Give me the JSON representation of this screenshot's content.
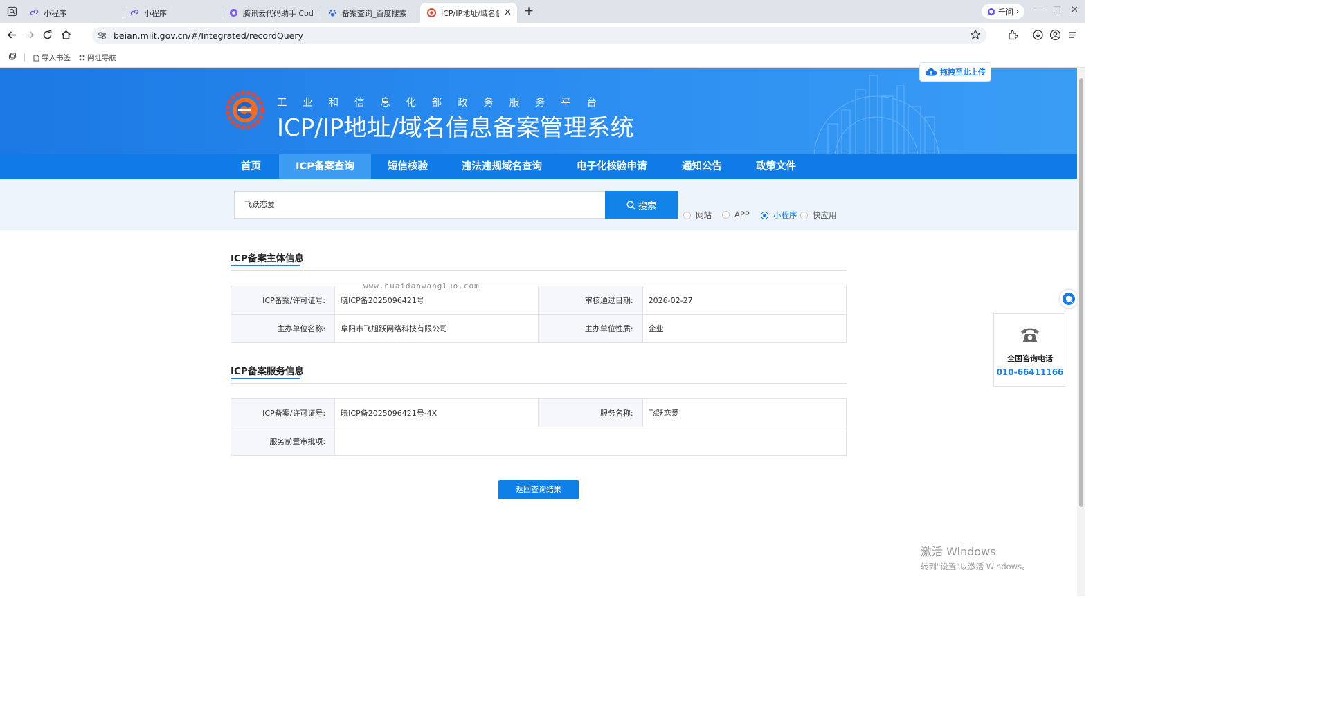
{
  "browser": {
    "tabs": [
      {
        "label": "小程序",
        "icon": "mini-program-icon"
      },
      {
        "label": "小程序",
        "icon": "mini-program-icon"
      },
      {
        "label": "腾讯云代码助手 CodeBu",
        "icon": "codebuddy-icon"
      },
      {
        "label": "备案查询_百度搜索",
        "icon": "baidu-icon"
      },
      {
        "label": "ICP/IP地址/域名信",
        "icon": "miit-icon",
        "active": true
      }
    ],
    "qianwen_label": "千问",
    "url": "beian.miit.gov.cn/#/Integrated/recordQuery",
    "bookmarks": [
      {
        "label": "导入书签",
        "icon": "import-bookmark-icon"
      },
      {
        "label": "网址导航",
        "icon": "grid-icon"
      }
    ]
  },
  "header": {
    "subtitle": "工业和信息化部政务服务平台",
    "title": "ICP/IP地址/域名信息备案管理系统",
    "upload_label": "拖拽至此上传"
  },
  "nav": {
    "items": [
      "首页",
      "ICP备案查询",
      "短信核验",
      "违法违规域名查询",
      "电子化核验申请",
      "通知公告",
      "政策文件"
    ],
    "active_index": 1
  },
  "search": {
    "value": "飞跃恋爱",
    "button_label": "搜索",
    "types": [
      "网站",
      "APP",
      "小程序",
      "快应用"
    ],
    "selected_type": "小程序"
  },
  "subject_info": {
    "title": "ICP备案主体信息",
    "license_label": "ICP备案/许可证号:",
    "license_value": "晓ICP备2025096421号",
    "approval_date_label": "审核通过日期:",
    "approval_date_value": "2026-02-27",
    "org_name_label": "主办单位名称:",
    "org_name_value": "阜阳市飞旭跃网络科技有限公司",
    "org_type_label": "主办单位性质:",
    "org_type_value": "企业"
  },
  "service_info": {
    "title": "ICP备案服务信息",
    "license_label": "ICP备案/许可证号:",
    "license_value": "晓ICP备2025096421号-4X",
    "service_name_label": "服务名称:",
    "service_name_value": "飞跃恋爱",
    "pre_approval_label": "服务前置审批项:",
    "pre_approval_value": ""
  },
  "watermark": "www.huaidanwangluo.com",
  "back_button_label": "返回查询结果",
  "hotline": {
    "label": "全国咨询电话",
    "phone": "010-66411166"
  },
  "os_notice": {
    "line1": "激活 Windows",
    "line2": "转到\"设置\"以激活 Windows。"
  },
  "colors": {
    "primary": "#0e7be6",
    "nav_active": "#3d9bf2",
    "accent_text": "#1a7ee6"
  }
}
